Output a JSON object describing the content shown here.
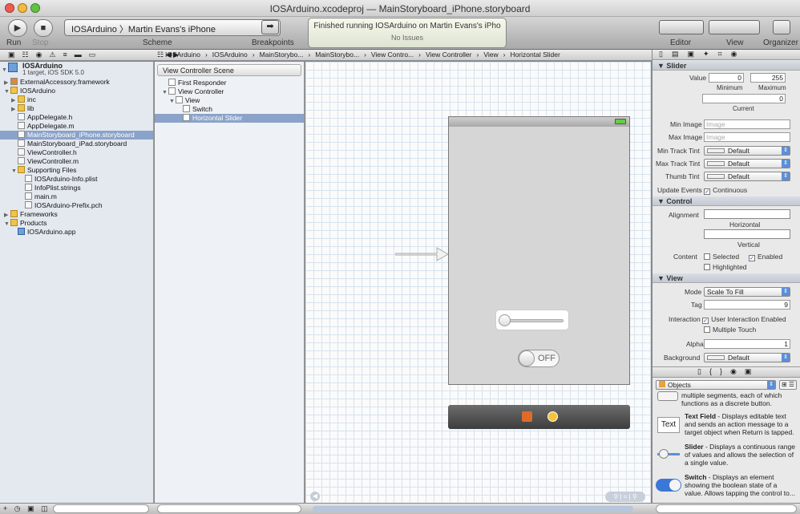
{
  "window": {
    "title": "IOSArduino.xcodeproj — MainStoryboard_iPhone.storyboard"
  },
  "toolbar": {
    "run_label": "Run",
    "stop_label": "Stop",
    "scheme_text": "IOSArduino 〉Martin Evans's iPhone",
    "scheme_label": "Scheme",
    "breakpoints_label": "Breakpoints",
    "status_line1": "Finished running IOSArduino on Martin Evans's iPho",
    "status_line2": "No Issues",
    "editor_label": "Editor",
    "view_label": "View",
    "organizer_label": "Organizer"
  },
  "breadcrumbs": [
    "IOSArduino",
    "IOSArduino",
    "MainStorybo...",
    "MainStorybo...",
    "View Contro...",
    "View Controller",
    "View",
    "Horizontal Slider"
  ],
  "navigator": {
    "project_name": "IOSArduino",
    "project_sub": "1 target, iOS SDK 5.0",
    "items": [
      {
        "label": "ExternalAccessory.framework",
        "indent": 1,
        "icon": "framework-icon",
        "disc": "▶"
      },
      {
        "label": "IOSArduino",
        "indent": 1,
        "icon": "folder-icon",
        "disc": "▼"
      },
      {
        "label": "inc",
        "indent": 2,
        "icon": "folder-icon",
        "disc": "▶"
      },
      {
        "label": "lib",
        "indent": 2,
        "icon": "folder-icon",
        "disc": "▶"
      },
      {
        "label": "AppDelegate.h",
        "indent": 2,
        "icon": "file-icon",
        "disc": ""
      },
      {
        "label": "AppDelegate.m",
        "indent": 2,
        "icon": "file-icon",
        "disc": ""
      },
      {
        "label": "MainStoryboard_iPhone.storyboard",
        "indent": 2,
        "icon": "file-icon",
        "disc": "",
        "selected": true
      },
      {
        "label": "MainStoryboard_iPad.storyboard",
        "indent": 2,
        "icon": "file-icon",
        "disc": ""
      },
      {
        "label": "ViewController.h",
        "indent": 2,
        "icon": "file-icon",
        "disc": ""
      },
      {
        "label": "ViewController.m",
        "indent": 2,
        "icon": "file-icon",
        "disc": ""
      },
      {
        "label": "Supporting Files",
        "indent": 2,
        "icon": "folder-icon",
        "disc": "▼"
      },
      {
        "label": "IOSArduino-Info.plist",
        "indent": 3,
        "icon": "file-icon",
        "disc": ""
      },
      {
        "label": "InfoPlist.strings",
        "indent": 3,
        "icon": "file-icon",
        "disc": ""
      },
      {
        "label": "main.m",
        "indent": 3,
        "icon": "file-icon",
        "disc": ""
      },
      {
        "label": "IOSArduino-Prefix.pch",
        "indent": 3,
        "icon": "file-icon",
        "disc": ""
      },
      {
        "label": "Frameworks",
        "indent": 1,
        "icon": "folder-icon",
        "disc": "▶"
      },
      {
        "label": "Products",
        "indent": 1,
        "icon": "folder-icon",
        "disc": "▼"
      },
      {
        "label": "IOSArduino.app",
        "indent": 2,
        "icon": "app-icon",
        "disc": ""
      }
    ]
  },
  "outline": {
    "header": "View Controller Scene",
    "items": [
      {
        "label": "First Responder",
        "indent": 1,
        "disc": ""
      },
      {
        "label": "View Controller",
        "indent": 1,
        "disc": "▼"
      },
      {
        "label": "View",
        "indent": 2,
        "disc": "▼"
      },
      {
        "label": "Switch",
        "indent": 3,
        "disc": ""
      },
      {
        "label": "Horizontal Slider",
        "indent": 3,
        "disc": "",
        "selected": true
      }
    ]
  },
  "canvas": {
    "switch_text": "OFF",
    "slider_value": 0
  },
  "inspector": {
    "slider_header": "Slider",
    "value_label": "Value",
    "min_value": "0",
    "max_value": "255",
    "minimum_label": "Minimum",
    "maximum_label": "Maximum",
    "current_value": "0",
    "current_label": "Current",
    "min_image_label": "Min Image",
    "max_image_label": "Max Image",
    "image_placeholder": "Image",
    "min_track_label": "Min Track Tint",
    "max_track_label": "Max Track Tint",
    "thumb_tint_label": "Thumb Tint",
    "tint_value": "Default",
    "update_events_label": "Update Events",
    "continuous_label": "Continuous",
    "control_header": "Control",
    "alignment_label": "Alignment",
    "horizontal_label": "Horizontal",
    "vertical_label": "Vertical",
    "content_label": "Content",
    "selected_label": "Selected",
    "enabled_label": "Enabled",
    "highlighted_label": "Highlighted",
    "view_header": "View",
    "mode_label": "Mode",
    "mode_value": "Scale To Fill",
    "tag_label": "Tag",
    "tag_value": "9",
    "interaction_label": "Interaction",
    "user_interaction_label": "User Interaction Enabled",
    "multiple_touch_label": "Multiple Touch",
    "alpha_label": "Alpha",
    "alpha_value": "1",
    "background_label": "Background",
    "background_value": "Default"
  },
  "library": {
    "selector": "Objects",
    "segmented_desc": "multiple segments, each of which functions as a discrete button.",
    "text_field_icon_text": "Text",
    "text_field_title": "Text Field",
    "text_field_desc": " - Displays editable text and sends an action message to a target object when Return is tapped.",
    "slider_title": "Slider",
    "slider_desc": " - Displays a continuous range of values and allows the selection of a single value.",
    "switch_title": "Switch",
    "switch_desc": " - Displays an element showing the boolean state of a value. Allows tapping the control to..."
  }
}
